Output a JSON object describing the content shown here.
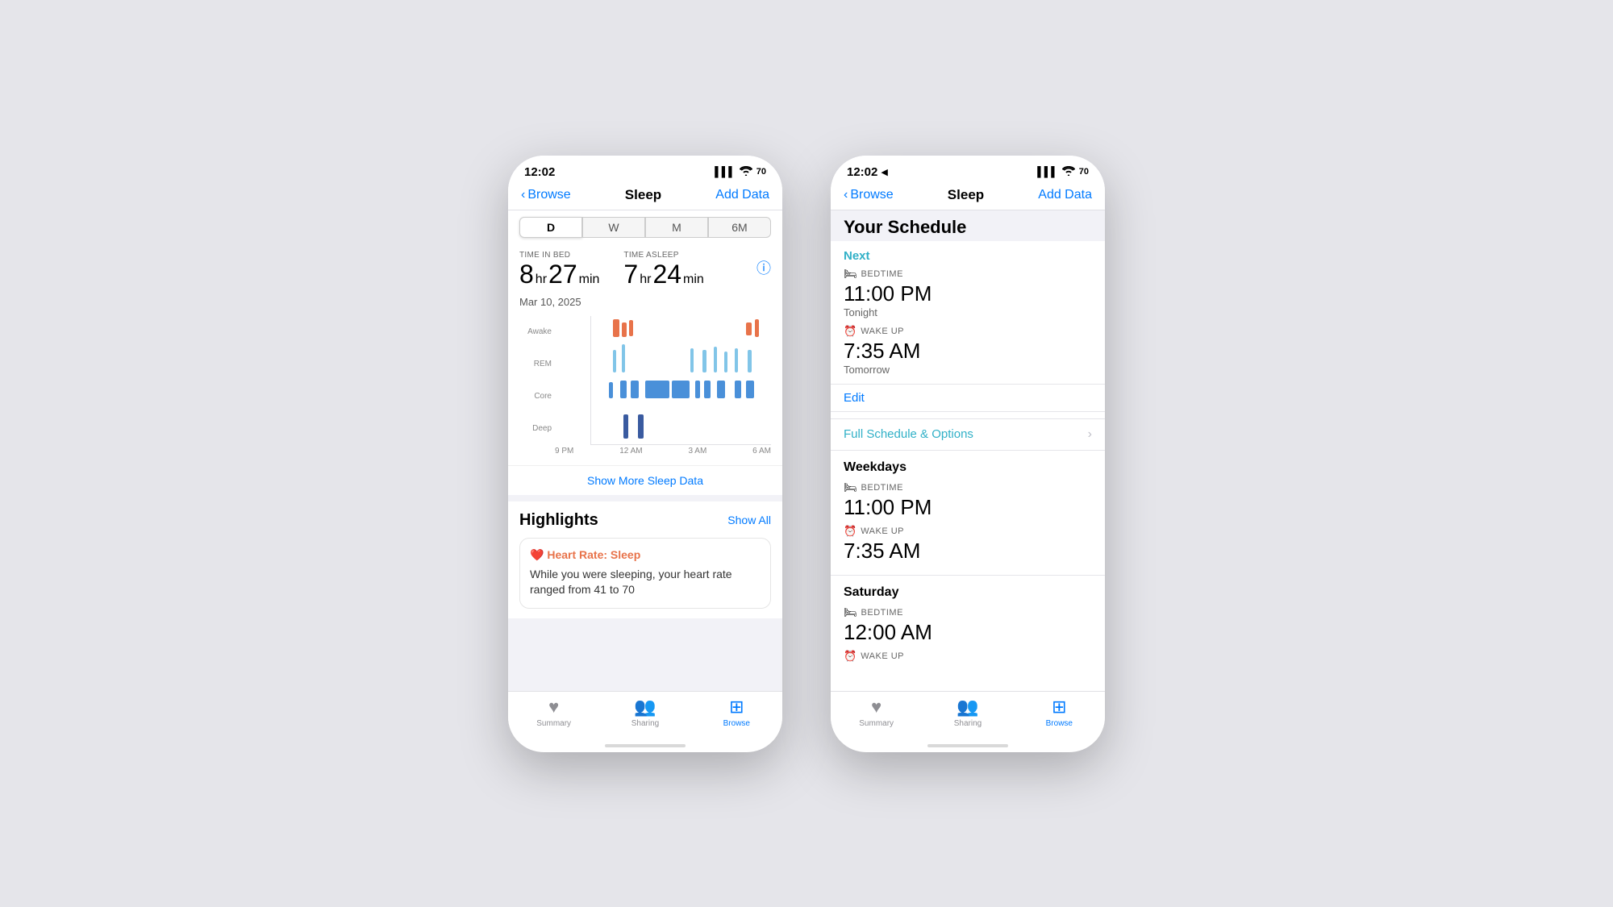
{
  "phone1": {
    "statusBar": {
      "time": "12:02",
      "icons": "▌▌▌ ● 70"
    },
    "nav": {
      "back": "Browse",
      "title": "Sleep",
      "action": "Add Data"
    },
    "segments": [
      "D",
      "W",
      "M",
      "6M"
    ],
    "activeSegment": 0,
    "stats": {
      "timeInBed": {
        "label": "TIME IN BED",
        "hours": "8",
        "hrUnit": "hr",
        "mins": "27",
        "minUnit": "min"
      },
      "timeAsleep": {
        "label": "TIME ASLEEP",
        "hours": "7",
        "hrUnit": "hr",
        "mins": "24",
        "minUnit": "min"
      }
    },
    "date": "Mar 10, 2025",
    "chartLabels": {
      "y": [
        "Awake",
        "REM",
        "Core",
        "Deep"
      ],
      "x": [
        "9 PM",
        "12 AM",
        "3 AM",
        "6 AM"
      ]
    },
    "showMore": "Show More Sleep Data",
    "highlights": {
      "title": "Highlights",
      "showAll": "Show All",
      "card": {
        "icon": "❤️",
        "title": "Heart Rate: Sleep",
        "text": "While you were sleeping, your heart rate ranged from 41 to 70"
      }
    },
    "tabBar": {
      "items": [
        {
          "icon": "♥",
          "label": "Summary",
          "active": false
        },
        {
          "icon": "👥",
          "label": "Sharing",
          "active": false
        },
        {
          "icon": "⊞",
          "label": "Browse",
          "active": true
        }
      ]
    }
  },
  "phone2": {
    "statusBar": {
      "time": "12:02",
      "icons": "▌▌▌ ● 70"
    },
    "nav": {
      "back": "Browse",
      "title": "Sleep",
      "action": "Add Data"
    },
    "schedule": {
      "sectionTitle": "Your Schedule",
      "nextLabel": "Next",
      "bedtimeLabel": "BEDTIME",
      "bedtimeTime": "11:00 PM",
      "bedtimeWhen": "Tonight",
      "wakeupLabel": "WAKE UP",
      "wakeupTime": "7:35 AM",
      "wakeupWhen": "Tomorrow",
      "editLabel": "Edit",
      "fullScheduleLabel": "Full Schedule & Options",
      "weekdaysTitle": "Weekdays",
      "weekdaysBedtimeLabel": "BEDTIME",
      "weekdaysBedtimeTime": "11:00 PM",
      "weekdaysWakeupLabel": "WAKE UP",
      "weekdaysWakeupTime": "7:35 AM",
      "saturdayTitle": "Saturday",
      "saturdayBedtimeLabel": "BEDTIME",
      "saturdayBedtimeTime": "12:00 AM",
      "saturdayWakeupLabel": "WAKE UP"
    },
    "tabBar": {
      "items": [
        {
          "icon": "♥",
          "label": "Summary",
          "active": false
        },
        {
          "icon": "👥",
          "label": "Sharing",
          "active": false
        },
        {
          "icon": "⊞",
          "label": "Browse",
          "active": true
        }
      ]
    }
  }
}
